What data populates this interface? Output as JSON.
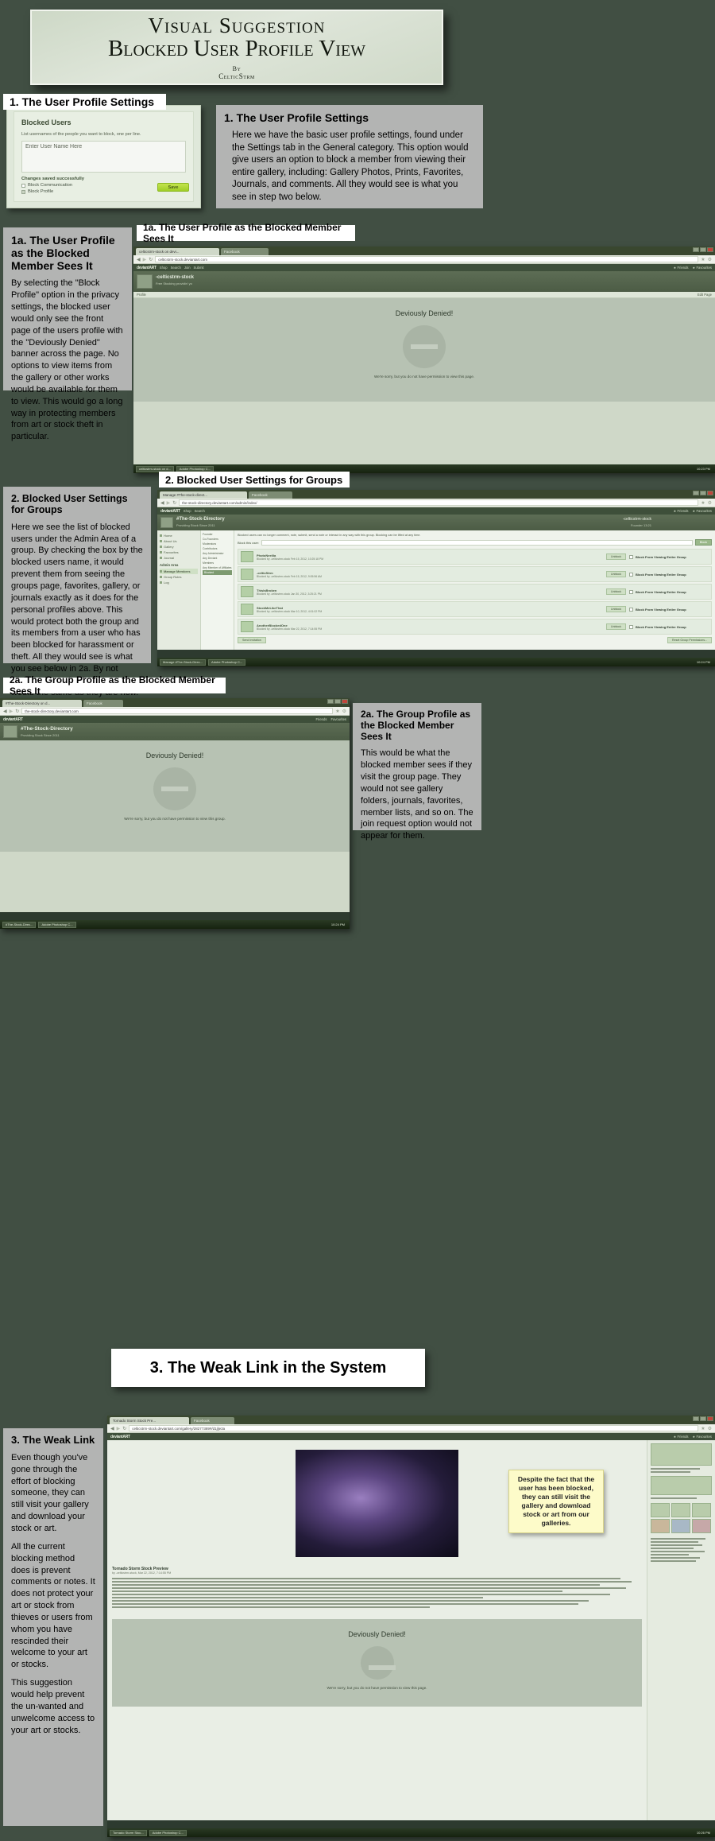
{
  "title_banner": {
    "line1": "Visual Suggestion",
    "line2": "Blocked User Profile View",
    "by": "By",
    "author": "CelticStrm"
  },
  "section1": {
    "header_label": "1. The User Profile Settings",
    "panel_title": "1. The User Profile Settings",
    "panel_body": "Here we have the basic user profile settings, found under the Settings tab in the General category. This option would give users an option to block a member from viewing their entire gallery, including:  Gallery Photos, Prints, Favorites, Journals, and comments. All they would see is what you see in step two below.",
    "settings": {
      "title": "Blocked Users",
      "subtitle": "List usernames of the people you want to block, one per line.",
      "input_placeholder": "Enter User Name Here",
      "saved_message": "Changes saved successfully",
      "checkbox_block_communication": "Block Communication",
      "checkbox_block_profile": "Block Profile",
      "save_button": "Save"
    }
  },
  "section1a": {
    "header_label": "1a. The User Profile as the Blocked Member Sees It",
    "panel_title": "1a. The User Profile as the Blocked Member Sees It",
    "panel_body": "By selecting the \"Block Profile\" option in the privacy settings, the blocked user would only see the front page of the users profile with the \"Deviously Denied\" banner across the page.  No options to view items from the gallery or other works would be available for them to view.  This would go a long way in protecting members from art or stock theft in particular.",
    "browser": {
      "tab_active": "celticstrm-stock on devi...",
      "tab_inactive": "Facebook",
      "url": "celticstrm-stock.deviantart.com",
      "nav_logo": "deviantART",
      "nav_items": [
        "Shop",
        "Search",
        "Join",
        "deviantART",
        "Submit"
      ],
      "nav_right": [
        "Friends",
        "Favourites"
      ],
      "profile_name": "-celticstrm-stock",
      "profile_sub": "Free Stocking providin' yo",
      "subnav_left": "Profile",
      "subnav_right": "Edit Page",
      "denied_title": "Deviously Denied!",
      "denied_message": "We're sorry, but you do not have permission to view this page.",
      "taskbar_items": [
        "celticstrm-stock on d...",
        "Adobe Photoshop C..."
      ],
      "clock": "10:23 PM"
    }
  },
  "section2": {
    "header_label": "2. Blocked User Settings for Groups",
    "panel_title": "2. Blocked User Settings for Groups",
    "panel_body": "Here we see the list of blocked users under the Admin Area of a group. By checking the box by the blocked users name, it would prevent them from seeing the groups page, favorites, gallery, or journals exactly as it does for the personal profiles above. This would protect both the group and its members from a user who has been blocked for harassment or theft. All they would see is what you see below in 2a. By not clicking the option ban restrictions would the same as they are now.",
    "browser": {
      "tab_active": "Manage #The-stock-direct...",
      "tab_inactive": "Facebook",
      "url": "the-stock-directory.deviantart.com/admin/index/",
      "nav_logo": "deviantART",
      "group_name": "#The-Stock-Directory",
      "group_sub": "Providing Stock Since 2011",
      "sidebar_sections": [
        {
          "header": "",
          "items": [
            "Home",
            "About Us",
            "Gallery",
            "Favourites",
            "Journal"
          ]
        },
        {
          "header": "Admin Area",
          "items": [
            "Manage Members",
            "Group Rules",
            "Log"
          ]
        }
      ],
      "selected_sidebar_item": "Manage Members",
      "note": "Blocked users can no longer comment, note, submit, send a note or interact in any way with this group. Blocking can be lifted at any time.",
      "block_label": "Block this user:",
      "block_button": "Block",
      "blocked_users": [
        {
          "name": "PhotoNeeilia",
          "meta": "Blocked by -celticstrm-stock Feb 15, 2012, 10:25:18 PM",
          "unblock": "Unblock",
          "checkbox_label": "Block From Viewing Entire Group",
          "checked": false
        },
        {
          "name": "-celticStrm",
          "meta": "Blocked by -celticstrm-stock Feb 15, 2012, 9:05:56 AM",
          "unblock": "Unblock",
          "checkbox_label": "Block From Viewing Entire Group",
          "checked": false
        },
        {
          "name": "ThisIsBroken",
          "meta": "Blocked by -celticstrm-stock Jan 30, 2012, 3:25:21 PM",
          "unblock": "Unblock",
          "checkbox_label": "Block From Viewing Entire Group",
          "checked": false
        },
        {
          "name": "StockMeLikeThat",
          "meta": "Blocked by -celticstrm-stock Mar 10, 2012, 4:01:02 PM",
          "unblock": "Unblock",
          "checkbox_label": "Block From Viewing Entire Group",
          "checked": false
        },
        {
          "name": "AnotherBlockedOne",
          "meta": "Blocked by -celticstrm-stock Mar 22, 2012, 7:14:55 PM",
          "unblock": "Unblock",
          "checkbox_label": "Block From Viewing Entire Group",
          "checked": false
        }
      ],
      "footer_left": "Send Invitation",
      "footer_right": "Reset Group Permissions...",
      "member_name": "-celticstrm-stock",
      "member_sub": "Founder  13:21",
      "sidebar_extra": [
        "Founder",
        "Co-Founders",
        "Moderators",
        "Contributors",
        "Any Administrator",
        "Any Deviant",
        "Members",
        "Any Member of Affiliates",
        "Blocked"
      ],
      "taskbar_items": [
        "Manage #The-Stock-Direc...",
        "Adobe Photoshop C..."
      ],
      "clock": "10:24 PM"
    }
  },
  "section2a": {
    "header_label": "2a. The Group Profile as the Blocked Member Sees It",
    "panel_title": "2a. The Group Profile as the Blocked Member Sees It",
    "panel_body": "This would be what the blocked member sees if they visit the group page. They would not see gallery folders, journals, favorites, member lists, and so on. The join request option would not appear for them.",
    "browser": {
      "tab_active": "#The-Stock-Directory on d...",
      "tab_inactive": "Facebook",
      "url": "the-stock-directory.deviantart.com",
      "nav_logo": "deviantART",
      "nav_right": [
        "Friends",
        "Favourites"
      ],
      "group_name": "#The-Stock-Directory",
      "group_sub": "Providing Stock Since 2011",
      "denied_title": "Deviously Denied!",
      "denied_message": "We're sorry, but you do not have permission to view this group.",
      "taskbar_items": [
        "#The-Stock-Direc...",
        "Adobe Photoshop C..."
      ],
      "clock": "10:24 PM"
    }
  },
  "section3": {
    "header_label": "3.   The Weak Link in the System",
    "panel_title": "3. The Weak Link",
    "panel_body_1": "Even though you've gone through the effort of blocking someone, they can still visit your gallery and download your stock or art.",
    "panel_body_2": "All the current blocking method does is prevent comments or notes. It does not protect your art or stock from thieves or users from whom you have rescinded their welcome to your art or stocks.",
    "panel_body_3": "This suggestion would help prevent the un-wanted and  unwelcome access to your art or stocks.",
    "callout": "Despite the fact that the user has been blocked, they can still visit the gallery and download stock or art from our galleries.",
    "browser": {
      "tab_active": "Tornado Storm Stock Pre...",
      "tab_inactive": "Facebook",
      "url": "celticstrm-stock.deviantart.com/gallery/28277389#/d1jlje3a",
      "nav_logo": "deviantART",
      "art_title": "Tornado Storm Stock Preview",
      "art_meta": "by -celticstrm-stock, Mar 22, 2012, 7:14:55 PM",
      "denied_title": "Deviously Denied!",
      "denied_message": "We're sorry, but you do not have permission to view this page.",
      "taskbar_items": [
        "Tornado Storm Stoc...",
        "Adobe Photoshop C..."
      ],
      "clock": "10:26 PM"
    }
  },
  "icons": {
    "star": "star-icon",
    "wrench": "wrench-icon",
    "back": "back-arrow-icon",
    "forward": "forward-arrow-icon",
    "reload": "reload-icon",
    "close": "close-icon"
  }
}
